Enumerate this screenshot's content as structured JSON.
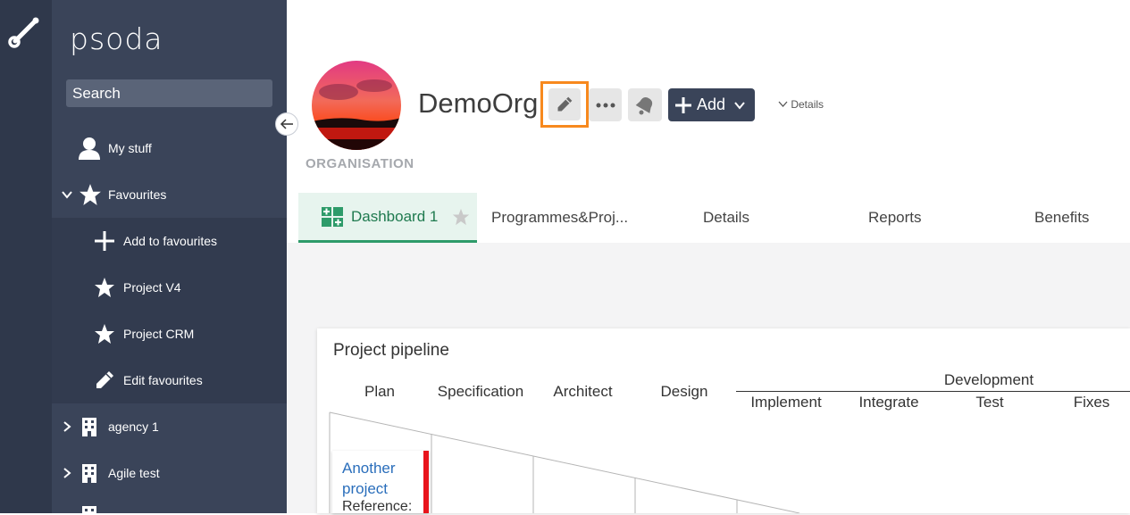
{
  "brand": "psoda",
  "search": {
    "placeholder": "Search"
  },
  "sidebar": {
    "items": [
      {
        "label": "My stuff"
      },
      {
        "label": "Favourites"
      },
      {
        "label": "Add to favourites"
      },
      {
        "label": "Project V4"
      },
      {
        "label": "Project CRM"
      },
      {
        "label": "Edit favourites"
      },
      {
        "label": "agency 1"
      },
      {
        "label": "Agile test"
      }
    ]
  },
  "header": {
    "org_name": "DemoOrg",
    "org_type": "ORGANISATION",
    "add_label": "Add",
    "details_label": "Details"
  },
  "tabs": [
    {
      "label": "Dashboard 1"
    },
    {
      "label": "Programmes&Proj..."
    },
    {
      "label": "Details"
    },
    {
      "label": "Reports"
    },
    {
      "label": "Benefits"
    }
  ],
  "pipeline": {
    "title": "Project pipeline",
    "columns": [
      "Plan",
      "Specification",
      "Architect",
      "Design"
    ],
    "group": "Development",
    "subcolumns": [
      "Implement",
      "Integrate",
      "Test",
      "Fixes"
    ],
    "project": {
      "name": "Another project",
      "reference": "Reference:"
    }
  },
  "colors": {
    "sidebar": "#3a4459",
    "rail": "#2f384b",
    "accent": "#f7891e",
    "active_tab": "#2e9b6a",
    "status_red": "#e8141c"
  }
}
